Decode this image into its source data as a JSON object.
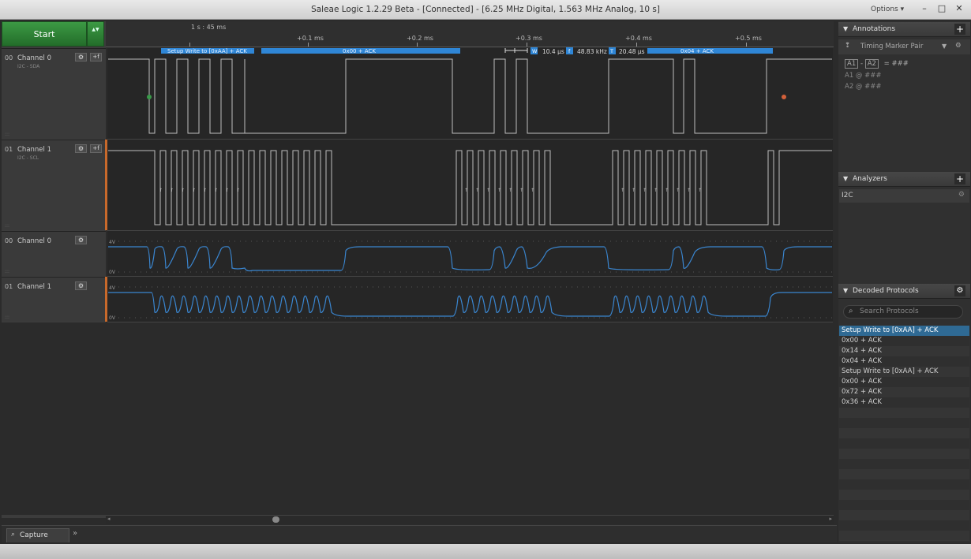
{
  "window": {
    "title": "Saleae Logic 1.2.29 Beta - [Connected] - [6.25 MHz Digital, 1.563 MHz Analog, 10 s]",
    "options_label": "Options ▾",
    "minimize": "–",
    "maximize": "□",
    "close": "✕"
  },
  "toolbar": {
    "start_label": "Start",
    "start_arrow": "▲▼"
  },
  "ruler": {
    "reference": "1 s : 45 ms",
    "ticks": [
      "+0.1 ms",
      "+0.2 ms",
      "+0.3 ms",
      "+0.4 ms",
      "+0.5 ms"
    ]
  },
  "decoded_bubbles": {
    "b1": "Setup Write to [0xAA] + ACK",
    "b2": "0x00 + ACK",
    "b3": "0x04 + ACK"
  },
  "measurements": {
    "w_icon": "W",
    "w_value": "10.4 µs",
    "f_icon": "f",
    "f_value": "48.83 kHz",
    "t_icon": "T",
    "t_value": "20.48 µs"
  },
  "channels": [
    {
      "num": "00",
      "name": "Channel 0",
      "sub": "I2C - SDA"
    },
    {
      "num": "01",
      "name": "Channel 1",
      "sub": "I2C - SCL"
    },
    {
      "num": "00",
      "name": "Channel 0",
      "sub": ""
    },
    {
      "num": "01",
      "name": "Channel 1",
      "sub": ""
    }
  ],
  "analog_labels": {
    "top": "4V",
    "bottom": "0V"
  },
  "tabs": {
    "capture": "Capture",
    "more": "»"
  },
  "annotations": {
    "header": "Annotations",
    "marker_pair": "Timing Marker Pair",
    "a1": "A1",
    "a2": "A2",
    "diff_value": "= ###",
    "a1_row": "A1  @  ###",
    "a2_row": "A2  @  ###"
  },
  "analyzers": {
    "header": "Analyzers",
    "items": [
      "I2C"
    ]
  },
  "decoded_protocols": {
    "header": "Decoded Protocols",
    "search_placeholder": "Search Protocols",
    "items": [
      "Setup Write to [0xAA] + ACK",
      "0x00 + ACK",
      "0x14 + ACK",
      "0x04 + ACK",
      "Setup Write to [0xAA] + ACK",
      "0x00 + ACK",
      "0x72 + ACK",
      "0x36 + ACK"
    ]
  },
  "colors": {
    "accent_green": "#2e8b3a",
    "marker_green": "#3a9a4a",
    "marker_red": "#d2603a",
    "analog_blue": "#3a86d0",
    "bubble_blue": "#2f86d6",
    "channel_orange": "#c8692b"
  }
}
